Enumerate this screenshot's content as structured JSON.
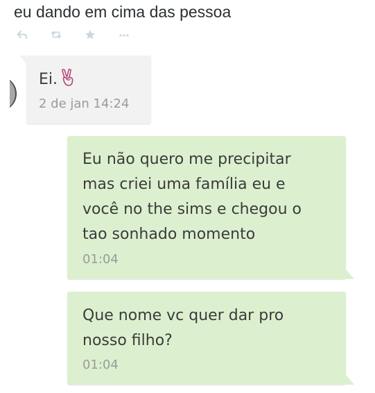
{
  "tweet": {
    "text": "eu dando em cima das pessoa",
    "actions": [
      {
        "icon": "reply-icon"
      },
      {
        "icon": "retweet-icon"
      },
      {
        "icon": "favorite-star-icon"
      },
      {
        "icon": "more-options-icon"
      }
    ]
  },
  "chat": {
    "messages": [
      {
        "direction": "incoming",
        "text": "Ei.",
        "emoji": "victory-hand-emoji",
        "time": "2 de jan 14:24"
      },
      {
        "direction": "outgoing",
        "lines": [
          "Eu não quero me precipitar",
          "mas criei uma família eu e",
          "você no the sims e chegou o",
          "tao sonhado momento"
        ],
        "time": "01:04"
      },
      {
        "direction": "outgoing",
        "lines": [
          "Que nome vc quer dar pro",
          "nosso filho?"
        ],
        "time": "01:04"
      }
    ]
  },
  "colors": {
    "incoming_bubble": "#f2f2f2",
    "outgoing_bubble": "#dcf0cf",
    "message_text": "#3b3b3b",
    "timestamp_text": "#9a9a9a",
    "tweet_text": "#292f33",
    "action_icon": "#ccd6dd"
  }
}
